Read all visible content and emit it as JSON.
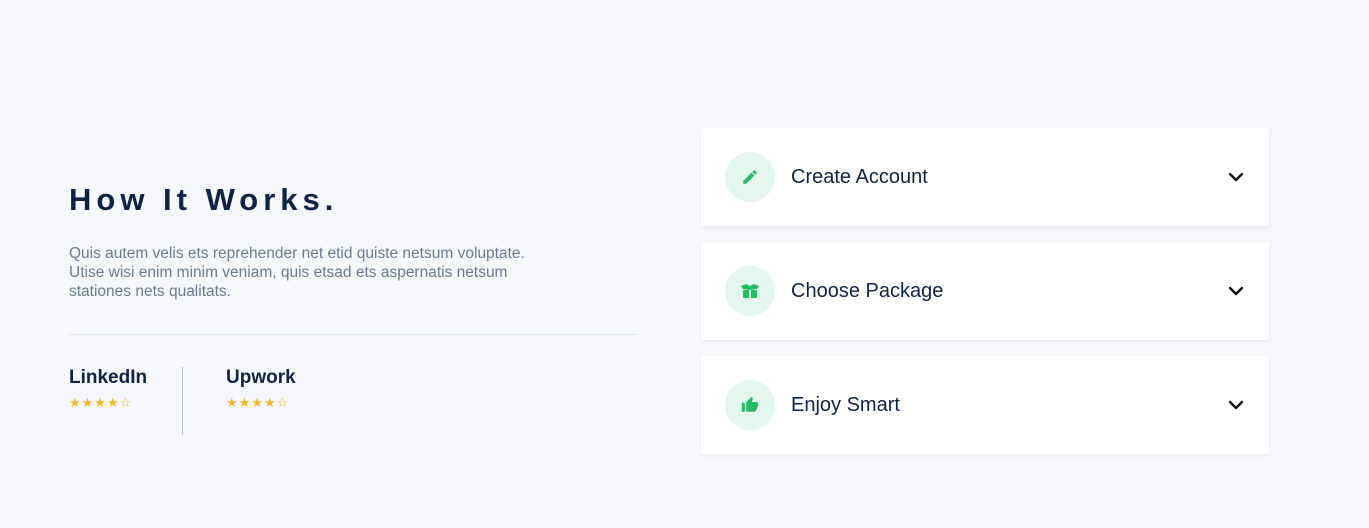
{
  "intro": {
    "title": "How It Works.",
    "description": "Quis autem velis ets reprehender net etid quiste netsum voluptate. Utise wisi enim minim veniam, quis etsad ets aspernatis netsum stationes nets qualitats."
  },
  "ratings": [
    {
      "name": "LinkedIn",
      "stars": "★★★★☆",
      "score": 4,
      "max": 5
    },
    {
      "name": "Upwork",
      "stars": "★★★★☆",
      "score": 4,
      "max": 5
    }
  ],
  "steps": [
    {
      "label": "Create Account",
      "icon": "pencil-icon"
    },
    {
      "label": "Choose Package",
      "icon": "package-icon"
    },
    {
      "label": "Enjoy Smart",
      "icon": "thumbs-up-icon"
    }
  ],
  "colors": {
    "background": "#f5f7fb",
    "heading": "#0f2347",
    "body_text": "#6b7a90",
    "accent_green": "#1fbf5f",
    "icon_circle": "#e4f7ee",
    "star": "#f6b821"
  }
}
